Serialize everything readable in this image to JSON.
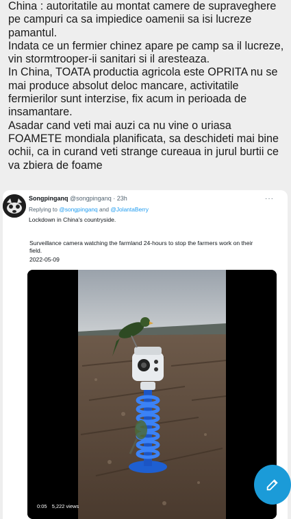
{
  "post": {
    "paragraphs": [
      "China : autoritatile au montat camere de supraveghere pe campuri ca sa impiedice oamenii sa isi lucreze pamantul.",
      "Indata ce un fermier chinez apare pe camp sa il lucreze, vin stormtrooper-ii sanitari si il aresteaza.",
      "In China, TOATA productia agricola este OPRITA nu se mai produce absolut deloc mancare, activitatile fermierilor sunt interzise, fix acum in perioada de insamantare.",
      "Asadar cand veti mai auzi ca nu vine o uriasa FOAMETE mondiala planificata, sa deschideti mai bine ochii, ca in curand veti strange cureaua in jurul burtii ce va zbiera de foame"
    ]
  },
  "tweet": {
    "author_name": "Songpinganq",
    "handle_time": "@songpinganq · 23h",
    "more_icon": "more-dots-icon",
    "reply_prefix": "Replying to",
    "reply_to_1": "@songpinganq",
    "reply_and": "and",
    "reply_to_2": "@JolantaBerry",
    "body": "Lockdown in China's countryside.",
    "quote": {
      "text": "Surveillance camera watching the farmland 24-hours to stop the farmers work on their field.",
      "date": "2022-05-09",
      "video": {
        "time": "0:05",
        "views": "5,222 views"
      }
    }
  },
  "fab": {
    "icon": "compose-icon",
    "color": "#1b9bd8"
  },
  "colors": {
    "background": "#eeeeee",
    "link": "#1d9bf0",
    "text": "#0f1419",
    "muted": "#536471"
  }
}
